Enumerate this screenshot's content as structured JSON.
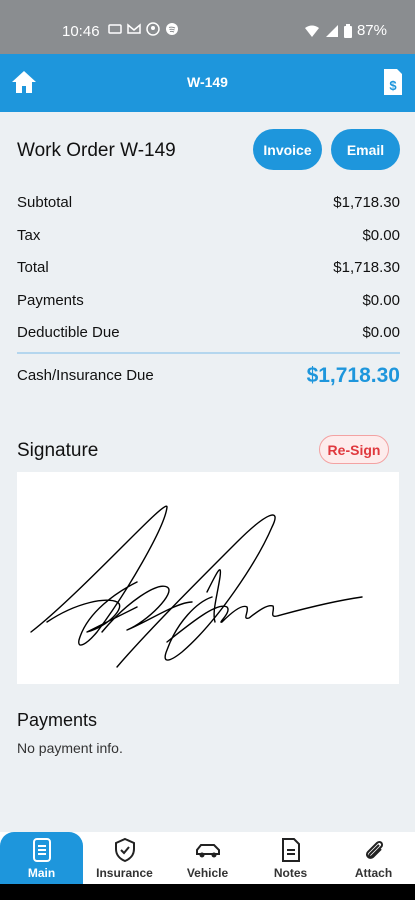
{
  "status": {
    "time": "10:46",
    "battery": "87%"
  },
  "nav": {
    "title": "W-149",
    "home_icon": "home-icon",
    "doc_icon": "invoice-doc-icon"
  },
  "order": {
    "heading": "Work Order W-149",
    "invoice_label": "Invoice",
    "email_label": "Email"
  },
  "totals": [
    {
      "label": "Subtotal",
      "value": "$1,718.30"
    },
    {
      "label": "Tax",
      "value": "$0.00"
    },
    {
      "label": "Total",
      "value": "$1,718.30"
    },
    {
      "label": "Payments",
      "value": "$0.00"
    },
    {
      "label": "Deductible Due",
      "value": "$0.00"
    }
  ],
  "due": {
    "label": "Cash/Insurance Due",
    "value": "$1,718.30"
  },
  "signature": {
    "title": "Signature",
    "resign_label": "Re-Sign"
  },
  "payments": {
    "title": "Payments",
    "empty_text": "No payment info."
  },
  "tabs": [
    {
      "label": "Main",
      "icon": "document-icon",
      "active": true
    },
    {
      "label": "Insurance",
      "icon": "shield-check-icon",
      "active": false
    },
    {
      "label": "Vehicle",
      "icon": "car-icon",
      "active": false
    },
    {
      "label": "Notes",
      "icon": "notes-icon",
      "active": false
    },
    {
      "label": "Attach",
      "icon": "paperclip-icon",
      "active": false
    }
  ],
  "colors": {
    "accent": "#1e96dc",
    "alert": "#e0393e",
    "background": "#ecf0f3"
  }
}
